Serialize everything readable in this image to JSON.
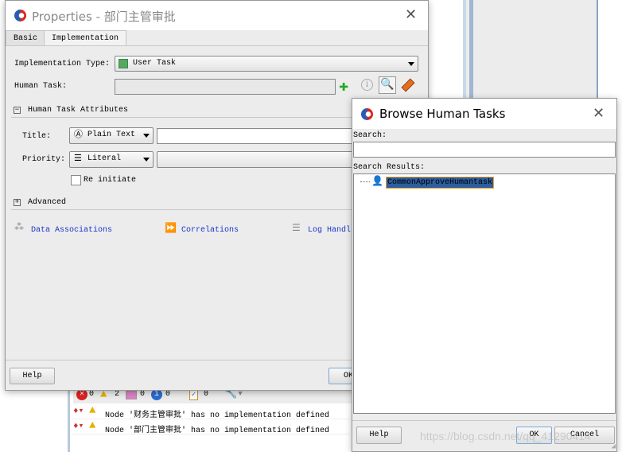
{
  "background": {
    "problems": {
      "counts": {
        "errors": "0",
        "warnings": "2",
        "other": "0",
        "info": "0",
        "tasks": "0"
      },
      "rows": [
        {
          "text": "Node '财务主管审批' has no implementation defined"
        },
        {
          "text": "Node '部门主管审批' has no implementation defined"
        }
      ]
    }
  },
  "properties": {
    "title": "Properties - 部门主管审批",
    "tabs": [
      {
        "label": "Basic"
      },
      {
        "label": "Implementation"
      }
    ],
    "impl_type_label": "Implementation Type:",
    "impl_type_value": "User Task",
    "human_task_label": "Human Task:",
    "human_task_value": "",
    "attributes_header": "Human Task Attributes",
    "title_label": "Title:",
    "title_mode": "Plain Text",
    "title_value": "",
    "priority_label": "Priority:",
    "priority_mode": "Literal",
    "priority_value": "",
    "reinitiate_label": "Re initiate",
    "reinitiate_checked": false,
    "advanced_header": "Advanced",
    "links": {
      "data_associations": "Data Associations",
      "correlations": "Correlations",
      "log_handler": "Log Handl"
    },
    "help_label": "Help",
    "ok_label": "OK"
  },
  "browse": {
    "title": "Browse Human Tasks",
    "search_label": "Search:",
    "search_value": "",
    "results_label": "Search Results:",
    "results": [
      {
        "label": "CommonApproveHumantask",
        "selected": true
      }
    ],
    "help_label": "Help",
    "ok_label": "OK",
    "cancel_label": "Cancel"
  },
  "watermark": "https://blog.csdn.net/qq_41290414",
  "colors": {
    "link": "#1a34c8",
    "selection": "#2d5e9e",
    "selection_border": "#f0a020"
  }
}
